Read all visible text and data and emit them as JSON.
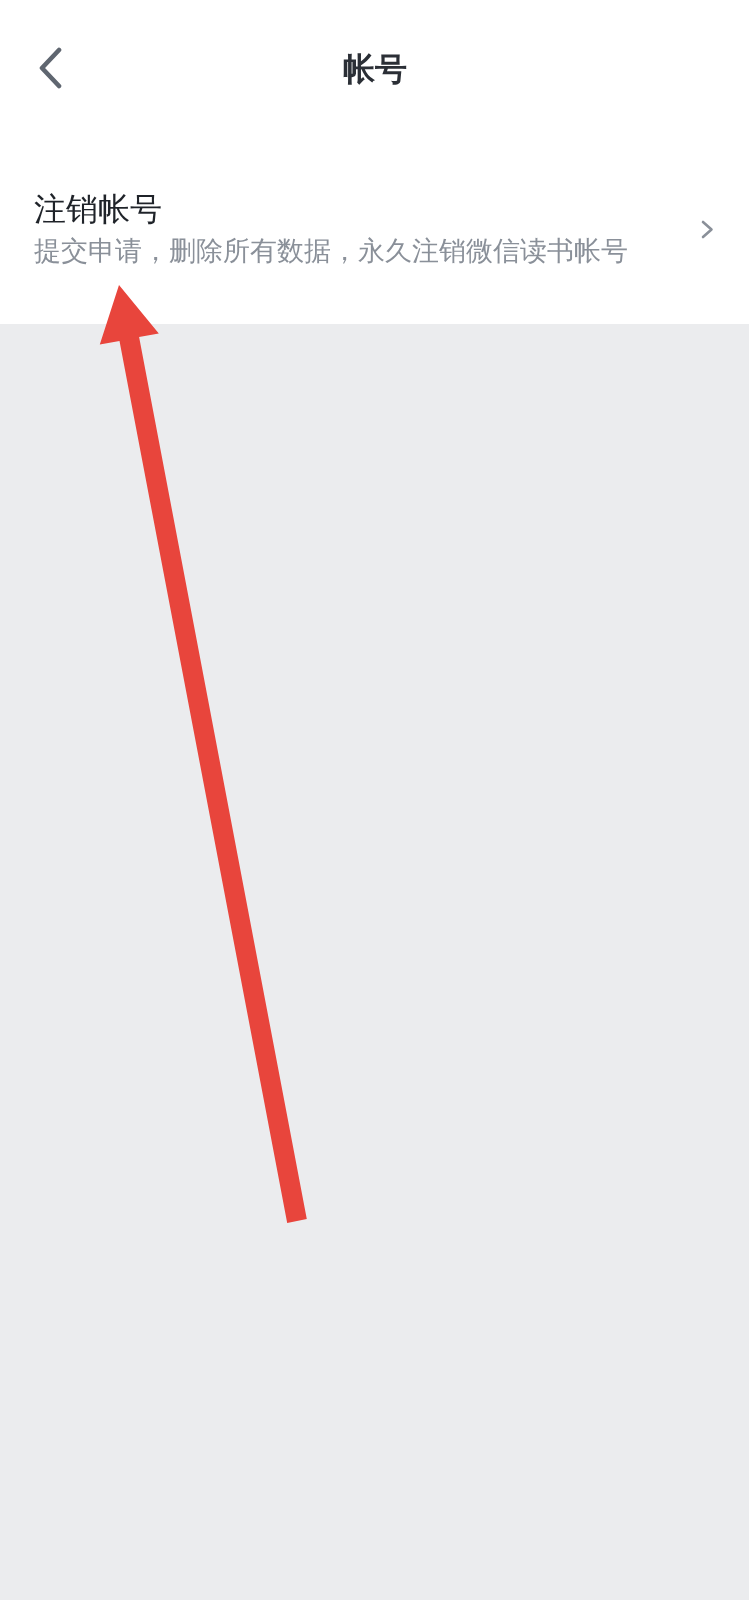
{
  "header": {
    "title": "帐号"
  },
  "settings_items": [
    {
      "title": "注销帐号",
      "subtitle": "提交申请，删除所有数据，永久注销微信读书帐号"
    }
  ]
}
